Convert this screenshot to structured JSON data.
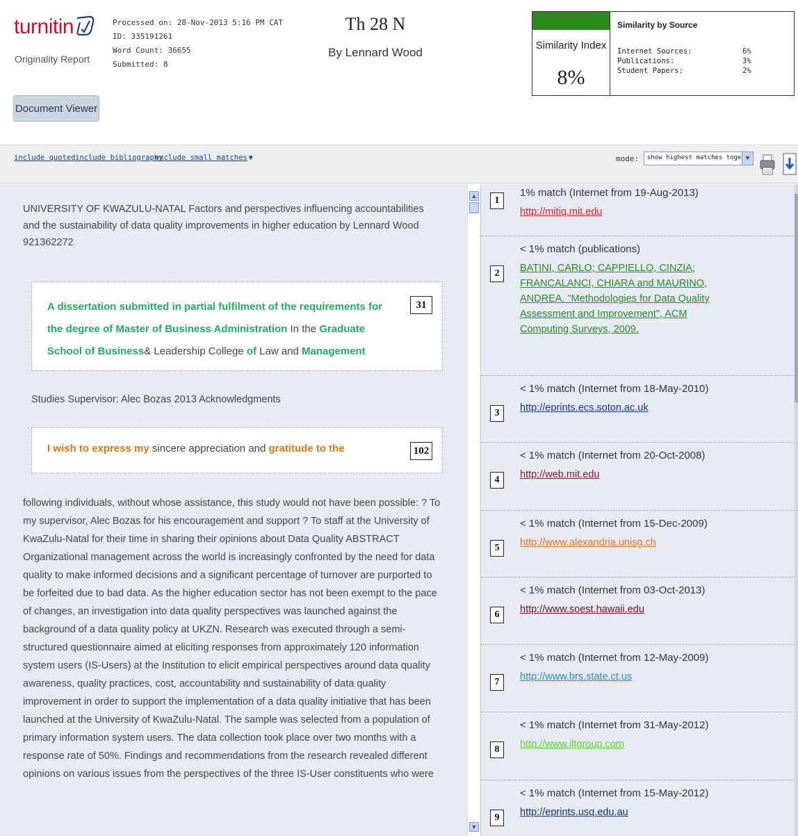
{
  "header": {
    "logo_text": "turnitin",
    "report_label": "Originality Report",
    "processed": "Processed on: 28-Nov-2013 5:16 PM CAT",
    "id": "ID: 335191261",
    "word_count": "Word Count: 36655",
    "submitted": "Submitted: 8",
    "title": "Th 28 N",
    "author": "By Lennard Wood",
    "document_viewer_label": "Document Viewer"
  },
  "similarity": {
    "index_label": "Similarity Index",
    "index_value": "8%",
    "index_color": "#2a8a1f",
    "by_source_label": "Similarity by Source",
    "rows": [
      {
        "label": "Internet Sources:",
        "value": "6%"
      },
      {
        "label": "Publications:",
        "value": "3%"
      },
      {
        "label": "Student Papers:",
        "value": "2%"
      }
    ]
  },
  "toolbar": {
    "include_quoted": "include quoted",
    "include_bibliography": "include bibliography",
    "exclude_small_matches": "exclude small matches",
    "mode_label": "mode:",
    "mode_value": "show highest matches together",
    "print_icon": "printer-icon",
    "download_icon": "download-icon"
  },
  "document": {
    "para1": "UNIVERSITY OF KWAZULU-NATAL Factors and perspectives influencing accountabilities and the sustainability of data quality improvements in higher education by Lennard Wood 921362272",
    "block1_number": "31",
    "block1_segments": [
      {
        "text": "A dissertation submitted in partial fulfilment of the requirements for the degree of Master of Business Administration",
        "hl": true
      },
      {
        "text": " In the ",
        "hl": false
      },
      {
        "text": "Graduate School of Business",
        "hl": true
      },
      {
        "text": "& Leadership College ",
        "hl": false
      },
      {
        "text": "of",
        "hl": true
      },
      {
        "text": " Law and ",
        "hl": false
      },
      {
        "text": "Management",
        "hl": true
      }
    ],
    "para2": "Studies Supervisor: Alec Bozas 2013 Acknowledgments",
    "block2_number": "102",
    "block2_segments": [
      {
        "text": "I wish to express my",
        "hl": true
      },
      {
        "text": " sincere appreciation and ",
        "hl": false
      },
      {
        "text": "gratitude to the",
        "hl": true
      }
    ],
    "para3": "following individuals, without whose assistance, this study would not have been possible: ? To my supervisor, Alec Bozas for his encouragement and support ? To staff at the University of KwaZulu-Natal for their time in sharing their opinions about Data Quality ABSTRACT Organizational management across the world is increasingly confronted by the need for data quality to make informed decisions and a significant percentage of turnover are purported to be forfeited due to bad data. As the higher education sector has not been exempt to the pace of changes, an investigation into data quality perspectives was launched against the background of a data quality policy at UKZN. Research was executed through a semi-structured questionnaire aimed at eliciting responses from approximately 120 information system users (IS-Users) at the Institution to elicit empirical perspectives around data quality awareness, quality practices, cost, accountability and sustainability of data quality improvement in order to support the implementation of a data quality initiative that has been launched at the University of KwaZulu-Natal. The sample was selected from a population of primary information system users. The data collection took place over two months with a response rate of 50%. Findings and recommendations from the research revealed different opinions on various issues from the perspectives of the three IS-User constituents who were"
  },
  "sources": [
    {
      "n": "1",
      "desc": "1% match (Internet from 19-Aug-2013)",
      "link": "http://mitiq.mit.edu",
      "color": "#e0201a"
    },
    {
      "n": "2",
      "desc": "< 1% match (publications)",
      "link": "BATINI, CARLO; CAPPIELLO, CINZIA; FRANCALANCI, CHIARA and MAURINO, ANDREA. \"Methodologies for Data Quality Assessment and Improvement\", ACM Computing Surveys, 2009.",
      "color": "#2a8a1f"
    },
    {
      "n": "3",
      "desc": "< 1% match (Internet from 18-May-2010)",
      "link": "http://eprints.ecs.soton.ac.uk",
      "color": "#1a2f9a"
    },
    {
      "n": "4",
      "desc": "< 1% match (Internet from 20-Oct-2008)",
      "link": "http://web.mit.edu",
      "color": "#8a1a2a"
    },
    {
      "n": "5",
      "desc": "< 1% match (Internet from 15-Dec-2009)",
      "link": "http://www.alexandria.unisg.ch",
      "color": "#f07020"
    },
    {
      "n": "6",
      "desc": "< 1% match (Internet from 03-Oct-2013)",
      "link": "http://www.soest.hawaii.edu",
      "color": "#6a1020"
    },
    {
      "n": "7",
      "desc": "< 1% match (Internet from 12-May-2009)",
      "link": "http://www.brs.state.ct.us",
      "color": "#2a8ad0"
    },
    {
      "n": "8",
      "desc": "< 1% match (Internet from 31-May-2012)",
      "link": "http://www.jltgroup.com",
      "color": "#5ad02a"
    },
    {
      "n": "9",
      "desc": "< 1% match (Internet from 15-May-2012)",
      "link": "http://eprints.usq.edu.au",
      "color": "#1a2f7a"
    }
  ]
}
